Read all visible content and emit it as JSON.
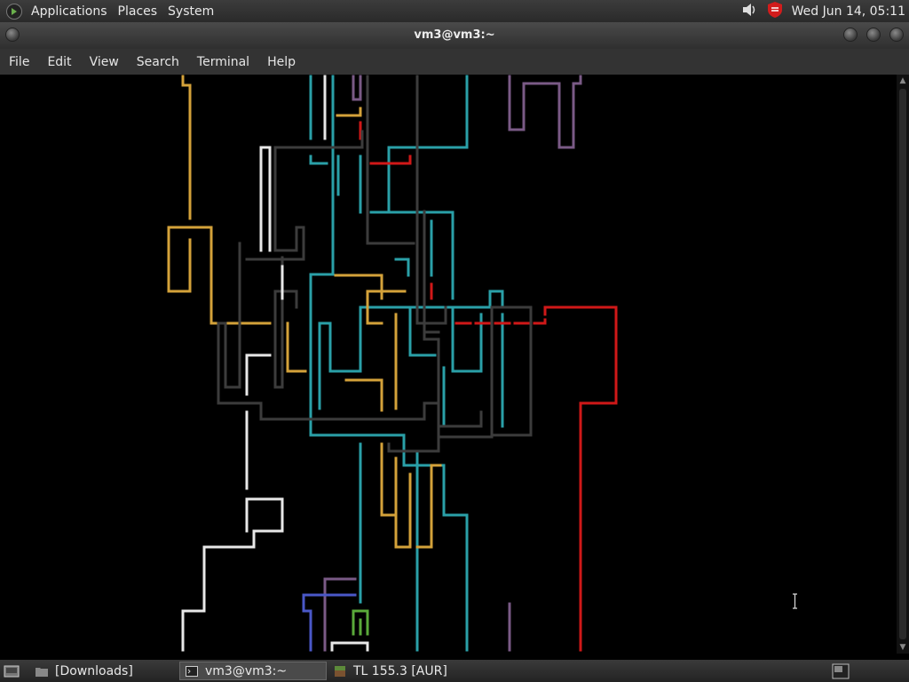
{
  "top_panel": {
    "menus": [
      "Applications",
      "Places",
      "System"
    ],
    "clock": "Wed Jun 14, 05:11"
  },
  "window": {
    "title": "vm3@vm3:~",
    "menu": [
      "File",
      "Edit",
      "View",
      "Search",
      "Terminal",
      "Help"
    ]
  },
  "taskbar": {
    "items": [
      "[Downloads]",
      "vm3@vm3:~",
      "TL 155.3 [AUR]"
    ]
  },
  "icons": {
    "app_logo": "gnome-foot-icon",
    "volume": "speaker-icon",
    "security": "shield-icon",
    "show_desktop": "desktop-icon",
    "folder": "folder-icon",
    "terminal": "terminal-icon",
    "game": "block-icon",
    "workspace": "workspace-icon"
  },
  "colors": {
    "teal": "#2aa0a8",
    "gold": "#d4a23a",
    "red": "#d01818",
    "gray": "#3c3c3c",
    "purple": "#7a5a86",
    "white": "#e8e8e8",
    "blue": "#4a58c8",
    "green": "#5aaa3a"
  }
}
